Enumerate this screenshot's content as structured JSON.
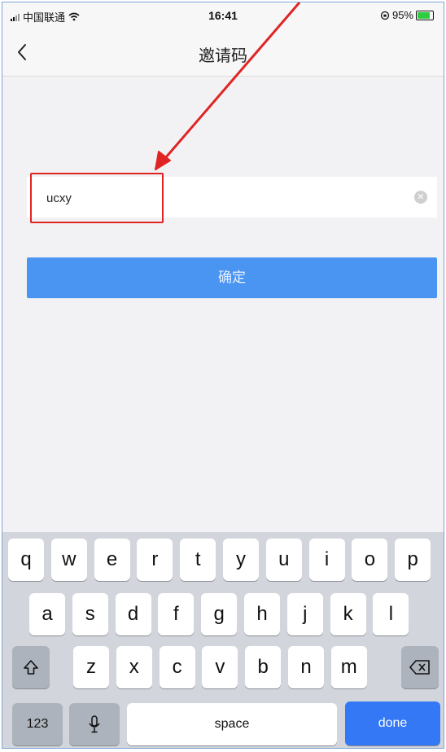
{
  "status_bar": {
    "carrier": "中国联通",
    "time": "16:41",
    "battery": "95%",
    "battery_level": 0.95
  },
  "nav": {
    "title": "邀请码"
  },
  "invite_field": {
    "value": "ucxy",
    "placeholder": ""
  },
  "confirm_button": {
    "label": "确定"
  },
  "keyboard": {
    "row1": [
      "q",
      "w",
      "e",
      "r",
      "t",
      "y",
      "u",
      "i",
      "o",
      "p"
    ],
    "row2": [
      "a",
      "s",
      "d",
      "f",
      "g",
      "h",
      "j",
      "k",
      "l"
    ],
    "row3": [
      "z",
      "x",
      "c",
      "v",
      "b",
      "n",
      "m"
    ],
    "numbers_label": "123",
    "space_label": "space",
    "done_label": "done"
  },
  "annotation": {
    "color": "#e02424"
  },
  "icons": {
    "back": "chevron-left-icon",
    "clear": "clear-icon",
    "shift": "shift-icon",
    "delete": "backspace-icon",
    "mic": "microphone-icon",
    "wifi": "wifi-icon",
    "signal": "signal-icon",
    "battery": "battery-icon"
  }
}
